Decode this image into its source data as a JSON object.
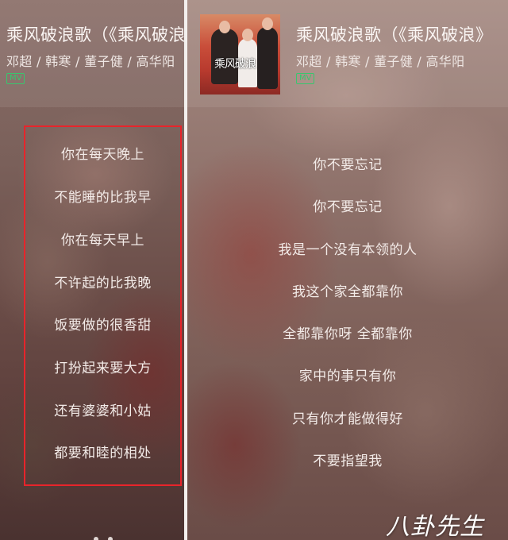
{
  "left": {
    "title": "乘风破浪歌（《乘风破浪》",
    "artists": "邓超 / 韩寒 / 董子健 / 高华阳",
    "mv_badge": "MV",
    "lyrics": [
      "你在每天晚上",
      "不能睡的比我早",
      "你在每天早上",
      "不许起的比我晚",
      "饭要做的很香甜",
      "打扮起来要大方",
      "还有婆婆和小姑",
      "都要和睦的相处"
    ]
  },
  "right": {
    "title": "乘风破浪歌（《乘风破浪》",
    "artists": "邓超 / 韩寒 / 董子健 / 高华阳",
    "mv_badge": "MV",
    "cover_text": "乘风破浪",
    "lyrics": [
      "你不要忘记",
      "你不要忘记",
      "我是一个没有本领的人",
      "我这个家全都靠你",
      "全都靠你呀 全都靠你",
      "家中的事只有你",
      "只有你才能做得好",
      "不要指望我"
    ]
  },
  "watermark": "八卦先生",
  "colors": {
    "highlight_border": "#e8242b",
    "mv_green": "#39c66e"
  }
}
